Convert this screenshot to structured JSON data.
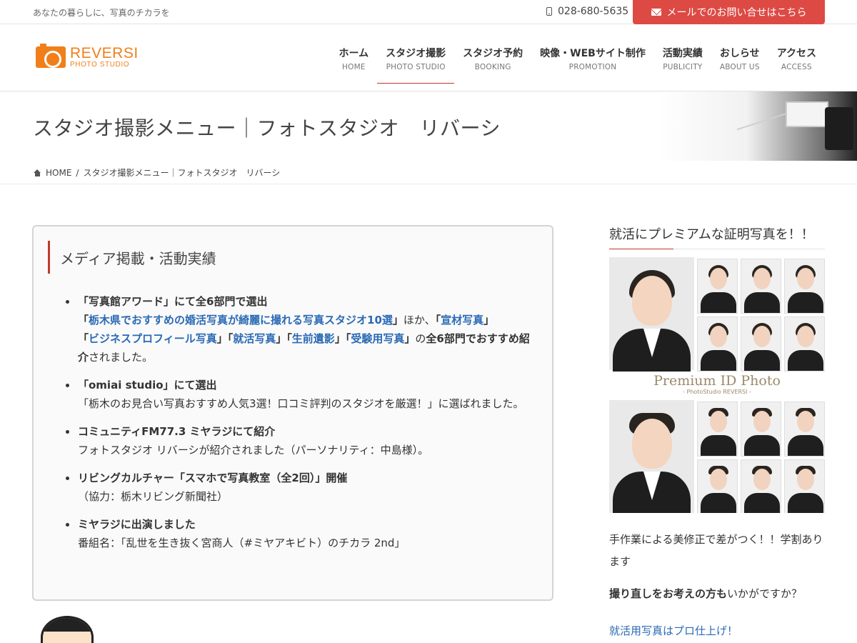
{
  "topbar": {
    "tagline": "あなたの暮らしに、写真のチカラを",
    "phone": "028-680-5635",
    "mail_button": "メールでのお問い合せはこちら"
  },
  "logo": {
    "main": "REVERSI",
    "sub": "PHOTO STUDIO"
  },
  "nav": [
    {
      "ja": "ホーム",
      "en": "HOME"
    },
    {
      "ja": "スタジオ撮影",
      "en": "PHOTO STUDIO"
    },
    {
      "ja": "スタジオ予約",
      "en": "BOOKING"
    },
    {
      "ja": "映像・WEBサイト制作",
      "en": "PROMOTION"
    },
    {
      "ja": "活動実績",
      "en": "PUBLICITY"
    },
    {
      "ja": "おしらせ",
      "en": "ABOUT US"
    },
    {
      "ja": "アクセス",
      "en": "ACCESS"
    }
  ],
  "page": {
    "title": "スタジオ撮影メニュー｜フォトスタジオ　リバーシ",
    "breadcrumb_home": "HOME",
    "breadcrumb_sep": "/",
    "breadcrumb_current": "スタジオ撮影メニュー｜フォトスタジオ　リバーシ"
  },
  "media": {
    "heading": "メディア掲載・活動実績",
    "item1": {
      "title": "「写真館アワード」にて全6部門で選出",
      "q_open": "「",
      "link1": "栃木県でおすすめの婚活写真が綺麗に撮れる写真スタジオ10選",
      "q_close": "」",
      "hoka": "ほか、",
      "link2": "宣材写真",
      "link3": "ビジネスプロフィール写真",
      "link4": "就活写真",
      "link5": "生前遺影",
      "link6": "受験用写真",
      "no": "の",
      "bold_end": "全6部門でおすすめ紹介",
      "tail": "されました。"
    },
    "item2": {
      "title": "「omiai studio」にて選出",
      "body": "「栃木のお見合い写真おすすめ人気3選！口コミ評判のスタジオを厳選！」に選ばれました。"
    },
    "item3": {
      "title": "コミュニティFM77.3 ミヤラジにて紹介",
      "body": "フォトスタジオ リバーシが紹介されました（パーソナリティ：中島様）。"
    },
    "item4": {
      "title": "リビングカルチャー「スマホで写真教室（全2回）」開催",
      "body": "（協力：栃木リビング新聞社）"
    },
    "item5": {
      "title": "ミヤラジに出演しました",
      "body": "番組名：「乱世を生き抜く宮商人（#ミヤアキビト）のチカラ 2nd」"
    }
  },
  "sidebar": {
    "title": "就活にプレミアムな証明写真を！！",
    "premium_title": "Premium ID Photo",
    "premium_sub": "- PhotoStudio REVERSI -",
    "text1": "手作業による美修正で差がつく！！学割あります",
    "text2_bold": "撮り直しをお考えの方も",
    "text2_rest": "いかがですか？",
    "link": "就活用写真はプロ仕上げ！"
  },
  "colors": {
    "accent_red": "#dd4a44",
    "logo_orange": "#f07f1a",
    "link_blue": "#2a6ab5"
  }
}
